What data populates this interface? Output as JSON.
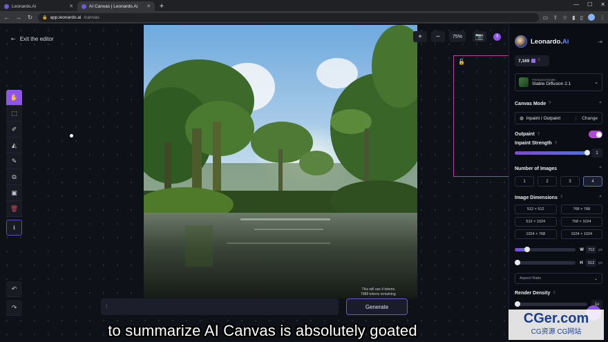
{
  "browser": {
    "tabs": [
      {
        "title": "Leonardo.Ai",
        "active": false
      },
      {
        "title": "AI Canvas | Leonardo.Ai",
        "active": true
      }
    ],
    "new_tab": "+",
    "url_host": "app.leonardo.ai",
    "url_path": "/canvas"
  },
  "editor": {
    "exit_label": "Exit the editor",
    "zoom_value": "75%",
    "zoom_in": "+",
    "zoom_out": "−",
    "notification_count": "3",
    "token_note_line1": "This will use 4 tokens.",
    "token_note_line2": "7988 tokens remaining.",
    "generate_label": "Generate",
    "tools": [
      "pan-tool",
      "select-tool",
      "erase-tool",
      "mask-tool",
      "draw-tool",
      "upload-tool",
      "image-tool",
      "delete-tool",
      "download-tool"
    ]
  },
  "panel": {
    "brand_main": "Leonardo.",
    "brand_accent": "Ai",
    "token_count": "7,169",
    "model_sub": "Finetuned Model",
    "model_name": "Stable Diffusion 2.1",
    "canvas_mode_title": "Canvas Mode",
    "canvas_mode_value": "Inpaint / Outpaint",
    "canvas_mode_change": "Change",
    "outpaint_label": "Outpaint",
    "outpaint_on": true,
    "inpaint_strength_label": "Inpaint Strength",
    "inpaint_strength_value": "1",
    "num_images_title": "Number of Images",
    "num_images_options": [
      "1",
      "2",
      "3",
      "4"
    ],
    "num_images_selected": "4",
    "dims_title": "Image Dimensions",
    "dims_options": [
      "512 × 512",
      "768 × 768",
      "512 × 1024",
      "768 × 1024",
      "1024 × 768",
      "1024 × 1024"
    ],
    "width_label": "W",
    "width_value": "712",
    "height_label": "H",
    "height_value": "512",
    "unit": "px",
    "width_slider_fraction": 0.2,
    "height_slider_fraction": 0.0,
    "aspect_label": "Aspect Ratio",
    "render_density_title": "Render Density",
    "render_density_value": "1x",
    "render_density_fraction": 0.0
  },
  "overlay": {
    "caption": "to summarize AI Canvas is absolutely goated",
    "watermark_main": "CGer.com",
    "watermark_sub": "CG资源 CG网站"
  },
  "colors": {
    "accent": "#8e55e8",
    "brand_blue": "#5f8bff",
    "outpaint_frame": "#b23fa6"
  }
}
